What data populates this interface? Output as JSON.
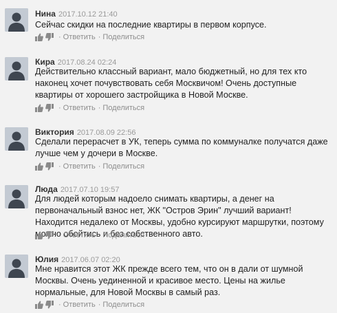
{
  "comments": [
    {
      "author": "Нина",
      "date": "2017.10.12 21:40",
      "text": "Сейчас скидки на последние квартиры в первом корпусе.",
      "reply_label": "Ответить",
      "share_label": "Поделиться",
      "separator": "·"
    },
    {
      "author": "Кира",
      "date": "2017.08.24 02:24",
      "text": "Действительно классный вариант, мало бюджетный, но для тех кто наконец хочет почувствовать себя Москвичом! Очень доступные квартиры от хорошего застройщика в Новой Москве.",
      "reply_label": "Ответить",
      "share_label": "Поделиться",
      "separator": "·"
    },
    {
      "author": "Виктория",
      "date": "2017.08.09 22:56",
      "text": "Сделали перерасчет в УК, теперь сумма по коммуналке получатся даже лучше чем у дочери в Москве.",
      "reply_label": "Ответить",
      "share_label": "Поделиться",
      "separator": "·"
    },
    {
      "author": "Люда",
      "date": "2017.07.10 19:57",
      "text": "Для людей которым надоело снимать квартиры, а денег на первоначальный взнос нет, ЖК \"Остров Эрин\" лучший вариант! Находится недалеко от Москвы, удобно курсируют маршрутки, поэтому можно обойтись и без собственного авто.",
      "reply_label": "Ответить",
      "share_label": "Поделиться",
      "separator": "·"
    },
    {
      "author": "Юлия",
      "date": "2017.06.07 02:20",
      "text": "Мне нравится этот ЖК прежде всего тем, что он в дали от шумной Москвы. Очень уединенной и красивое место. Цены на жилье нормальные, для Новой Москвы в самый раз.",
      "reply_label": "Ответить",
      "share_label": "Поделиться",
      "separator": "·"
    }
  ],
  "icons": {
    "avatar": "default-user-avatar",
    "like": "thumbs-up-icon",
    "dislike": "thumbs-down-icon"
  },
  "colors": {
    "background": "#f2f2f2",
    "avatar": "#c3cad3",
    "meta": "#999999"
  }
}
